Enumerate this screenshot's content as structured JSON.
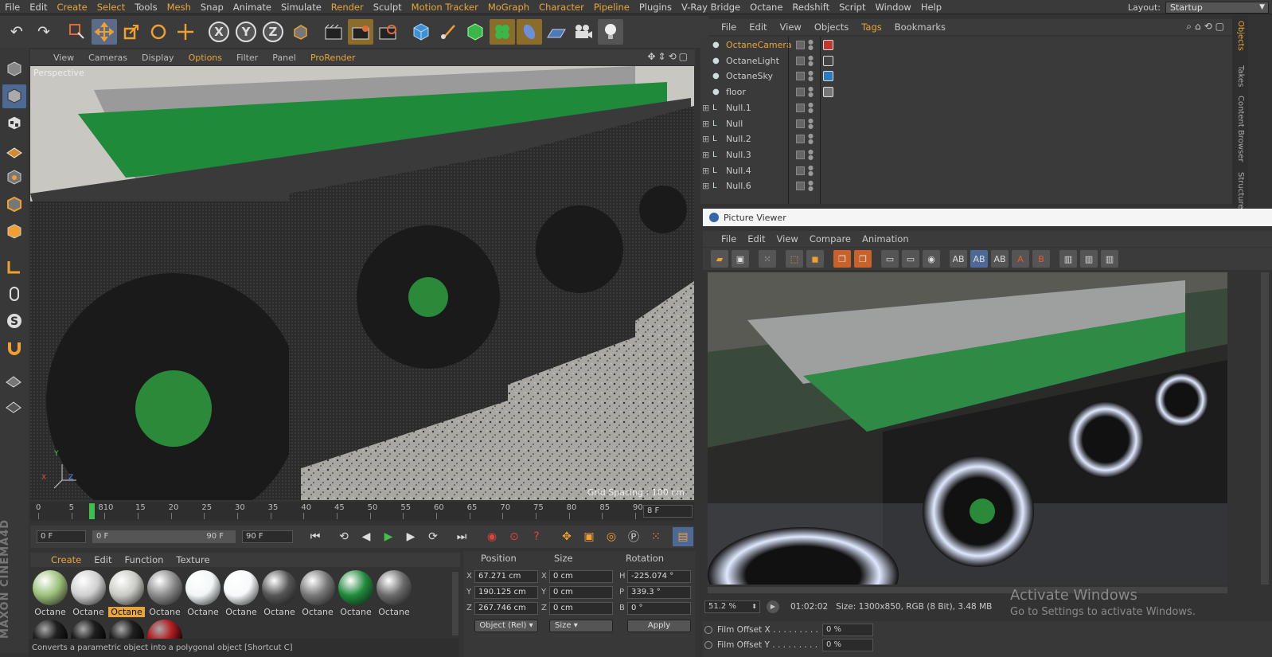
{
  "menubar": {
    "items": [
      {
        "label": "File",
        "hl": false
      },
      {
        "label": "Edit",
        "hl": false
      },
      {
        "label": "Create",
        "hl": true
      },
      {
        "label": "Select",
        "hl": true
      },
      {
        "label": "Tools",
        "hl": false
      },
      {
        "label": "Mesh",
        "hl": true
      },
      {
        "label": "Snap",
        "hl": false
      },
      {
        "label": "Animate",
        "hl": false
      },
      {
        "label": "Simulate",
        "hl": false
      },
      {
        "label": "Render",
        "hl": true
      },
      {
        "label": "Sculpt",
        "hl": false
      },
      {
        "label": "Motion Tracker",
        "hl": true
      },
      {
        "label": "MoGraph",
        "hl": true
      },
      {
        "label": "Character",
        "hl": true
      },
      {
        "label": "Pipeline",
        "hl": true
      },
      {
        "label": "Plugins",
        "hl": false
      },
      {
        "label": "V-Ray Bridge",
        "hl": false
      },
      {
        "label": "Octane",
        "hl": false
      },
      {
        "label": "Redshift",
        "hl": false
      },
      {
        "label": "Script",
        "hl": false
      },
      {
        "label": "Window",
        "hl": false
      },
      {
        "label": "Help",
        "hl": false
      }
    ],
    "layout_label": "Layout:",
    "layout_value": "Startup"
  },
  "toolbar": {
    "icons": [
      "undo-icon",
      "redo-icon",
      "live-selection-icon",
      "move-icon",
      "scale-icon",
      "rotate-icon",
      "recent-tool-icon",
      "x-axis-icon",
      "y-axis-icon",
      "z-axis-icon",
      "coordinate-system-icon",
      "render-view-icon",
      "render-picture-viewer-icon",
      "edit-render-settings-icon",
      "cube-icon",
      "pen-spline-icon",
      "subdivision-icon",
      "cloner-icon",
      "deformer-icon",
      "floor-icon",
      "camera-icon",
      "light-icon"
    ],
    "axis_x": "X",
    "axis_y": "Y",
    "axis_z": "Z"
  },
  "viewport": {
    "menu": [
      {
        "label": "View",
        "hl": false
      },
      {
        "label": "Cameras",
        "hl": false
      },
      {
        "label": "Display",
        "hl": false
      },
      {
        "label": "Options",
        "hl": true
      },
      {
        "label": "Filter",
        "hl": false
      },
      {
        "label": "Panel",
        "hl": false
      },
      {
        "label": "ProRender",
        "hl": true
      }
    ],
    "camera_label": "Perspective",
    "grid_spacing": "Grid Spacing : 100 cm",
    "axis_labels": {
      "x": "X",
      "y": "Y",
      "z": "Z"
    }
  },
  "timeline": {
    "ticks": [
      "0",
      "5",
      "810",
      "15",
      "20",
      "25",
      "30",
      "35",
      "40",
      "45",
      "50",
      "55",
      "60",
      "65",
      "70",
      "75",
      "80",
      "85",
      "90"
    ],
    "current_frame": "8 F",
    "playhead_frame": 8
  },
  "transport": {
    "start_frame": "0 F",
    "range_start": "0 F",
    "range_end": "90 F",
    "end_frame": "90 F"
  },
  "materials": {
    "menu": [
      {
        "label": "Create",
        "hl": true
      },
      {
        "label": "Edit",
        "hl": false
      },
      {
        "label": "Function",
        "hl": false
      },
      {
        "label": "Texture",
        "hl": false
      }
    ],
    "items": [
      {
        "label": "Octane",
        "color": "#9bbf7a",
        "selected": false
      },
      {
        "label": "Octane",
        "color": "#cfcfcf",
        "selected": false
      },
      {
        "label": "Octane",
        "color": "#c9c9c4",
        "selected": true
      },
      {
        "label": "Octane",
        "color": "#8a8a8a",
        "selected": false
      },
      {
        "label": "Octane",
        "color": "#f2f6f7",
        "selected": false
      },
      {
        "label": "Octane",
        "color": "#f7f9fa",
        "selected": false
      },
      {
        "label": "Octane",
        "color": "#555555",
        "selected": false
      },
      {
        "label": "Octane",
        "color": "#777777",
        "selected": false
      },
      {
        "label": "Octane",
        "color": "#1f8a3a",
        "selected": false
      },
      {
        "label": "Octane",
        "color": "#6a6a6a",
        "selected": false
      }
    ],
    "row2_colors": [
      "#222222",
      "#1e1e1e",
      "#202020",
      "#b52020"
    ]
  },
  "coords": {
    "headers": {
      "position": "Position",
      "size": "Size",
      "rotation": "Rotation"
    },
    "rows": [
      {
        "pl": "X",
        "pv": "67.271 cm",
        "sl": "X",
        "sv": "0 cm",
        "rl": "H",
        "rv": "-225.074 °"
      },
      {
        "pl": "Y",
        "pv": "190.125 cm",
        "sl": "Y",
        "sv": "0 cm",
        "rl": "P",
        "rv": "339.3 °"
      },
      {
        "pl": "Z",
        "pv": "267.746 cm",
        "sl": "Z",
        "sv": "0 cm",
        "rl": "B",
        "rv": "0 °"
      }
    ],
    "mode": "Object (Rel)",
    "size_mode": "Size",
    "apply": "Apply"
  },
  "objects": {
    "menu": [
      {
        "label": "File",
        "hl": false
      },
      {
        "label": "Edit",
        "hl": false
      },
      {
        "label": "View",
        "hl": false
      },
      {
        "label": "Objects",
        "hl": false
      },
      {
        "label": "Tags",
        "hl": true
      },
      {
        "label": "Bookmarks",
        "hl": false
      }
    ],
    "rows": [
      {
        "name": "OctaneCamera",
        "icon": "camera-icon",
        "selected": true
      },
      {
        "name": "OctaneLight",
        "icon": "light-icon",
        "selected": false
      },
      {
        "name": "OctaneSky",
        "icon": "sky-icon",
        "selected": false
      },
      {
        "name": "floor",
        "icon": "floor-icon",
        "selected": false
      },
      {
        "name": "Null.1",
        "icon": "null-icon",
        "selected": false
      },
      {
        "name": "Null",
        "icon": "null-icon",
        "selected": false
      },
      {
        "name": "Null.2",
        "icon": "null-icon",
        "selected": false
      },
      {
        "name": "Null.3",
        "icon": "null-icon",
        "selected": false
      },
      {
        "name": "Null.4",
        "icon": "null-icon",
        "selected": false
      },
      {
        "name": "Null.6",
        "icon": "null-icon",
        "selected": false
      }
    ],
    "side_tabs": [
      "Objects",
      "Takes",
      "Content Browser",
      "Structure"
    ]
  },
  "picture_viewer": {
    "title": "Picture Viewer",
    "menu": [
      "File",
      "Edit",
      "View",
      "Compare",
      "Animation"
    ],
    "zoom": "51.2 %",
    "time": "01:02:02",
    "size_info": "Size: 1300x850, RGB (8 Bit), 3.48 MB",
    "film_offset_x_label": "Film Offset X . . . . . . . . .",
    "film_offset_x_value": "0 %",
    "film_offset_y_label": "Film Offset Y . . . . . . . . .",
    "film_offset_y_value": "0 %"
  },
  "watermark": {
    "title": "Activate Windows",
    "subtitle": "Go to Settings to activate Windows."
  },
  "status": "Converts a parametric object into a polygonal object [Shortcut C]"
}
